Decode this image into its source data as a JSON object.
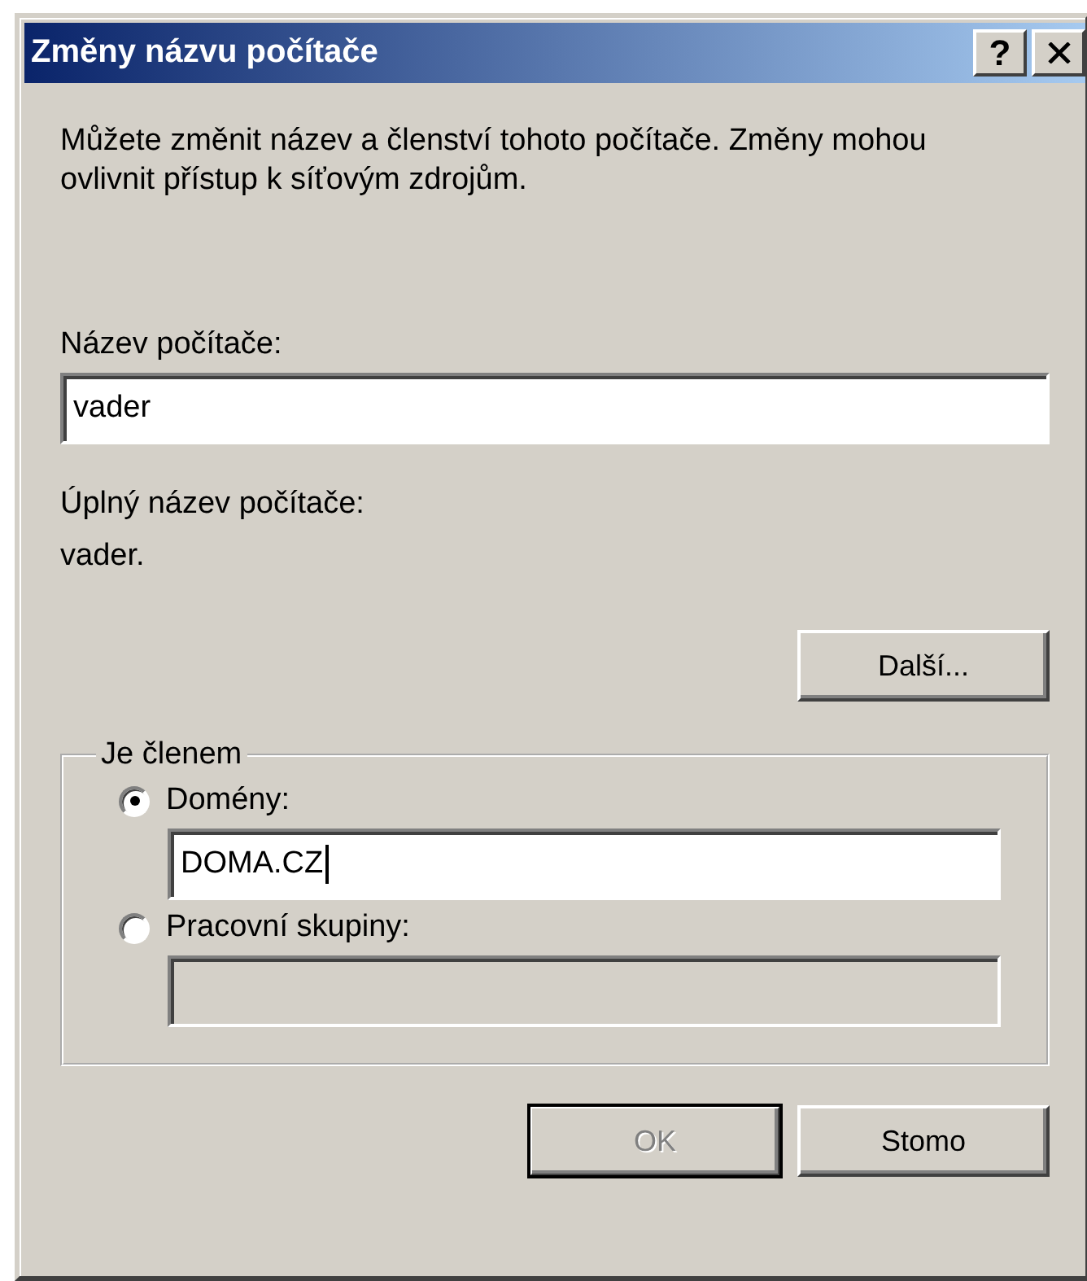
{
  "window": {
    "title": "Změny názvu počítače",
    "title_buttons": [
      {
        "kind": "help",
        "label": "?"
      },
      {
        "kind": "close"
      }
    ]
  },
  "intro": "Můžete změnit název a členství tohoto počítače. Změny mohou ovlivnit přístup k síťovým zdrojům.",
  "name_label": "Název počítače:",
  "name_field": {
    "value": "vader",
    "focused": false,
    "disabled": false
  },
  "full_name_label": "Úplný název počítače:",
  "full_name_value": "vader.",
  "more_button": {
    "label": "Další...",
    "disabled": false,
    "default": false
  },
  "membership": {
    "legend": "Je členem",
    "options": [
      {
        "label": "Domény:",
        "selected": true,
        "field": {
          "value": "DOMA.CZ",
          "focused": true,
          "disabled": false
        }
      },
      {
        "label": "Pracovní skupiny:",
        "selected": false,
        "field": {
          "focused": false,
          "disabled": true
        }
      }
    ]
  },
  "buttons": [
    {
      "label": "OK",
      "disabled": true,
      "default": true
    },
    {
      "label": "Stomo",
      "disabled": false,
      "default": false
    }
  ]
}
